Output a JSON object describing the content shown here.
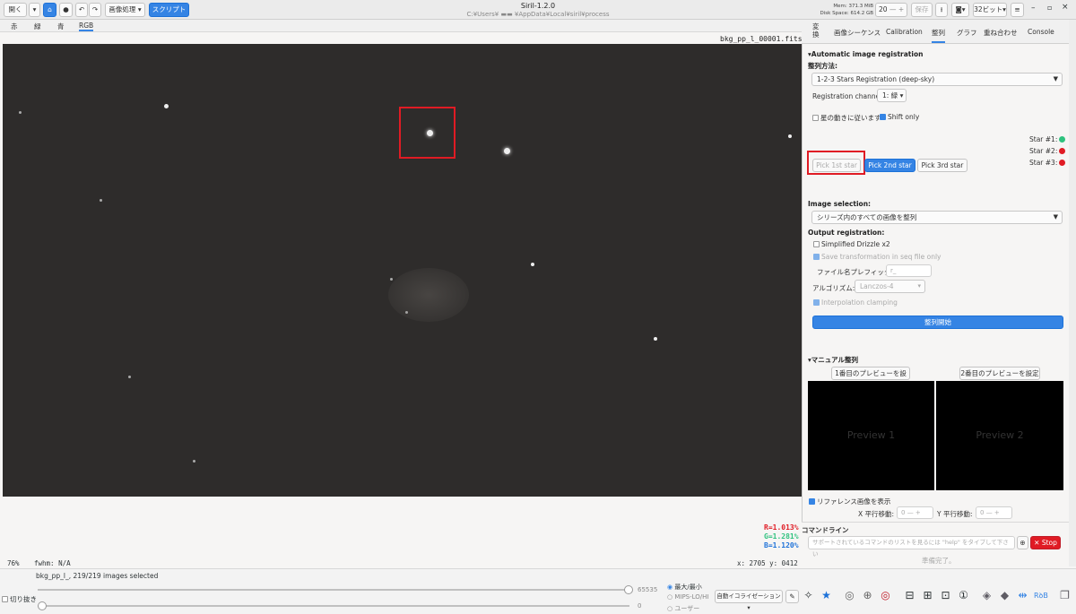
{
  "titlebar": {
    "open_label": "開く",
    "image_processing_label": "画像処理",
    "scripts_label": "スクリプト",
    "app_title": "Siril-1.2.0",
    "path": "C:¥Users¥ ▬▬ ¥AppData¥Local¥siril¥process",
    "mem": "Mem: 371.3 MiB",
    "disk": "Disk Space: 614.2 GB",
    "threads": "20",
    "save_label": "保存",
    "bit_depth": "32ビット"
  },
  "channels": [
    "赤",
    "緑",
    "青",
    "RGB"
  ],
  "viewer": {
    "filename": "bkg_pp_l_00001.fits",
    "zoom": "76%",
    "fwhm": "fwhm: N/A",
    "coords": "x: 2705 y: 0412",
    "r": "R=1.013%",
    "g": "G=1.281%",
    "b": "B=1.120%",
    "colors": {
      "r": "#e01b24",
      "g": "#2ec27e",
      "b": "#1c71d8"
    }
  },
  "sequence": {
    "info": "bkg_pp_l_, 219/219 images selected",
    "crop_label": "切り抜き",
    "max_value": "65535",
    "min_value": "0",
    "mode_max_min": "最大/最小",
    "mode_mips": "MIPS-LO/HI",
    "mode_user": "ユーザー",
    "auto_label": "自動イコライゼーション"
  },
  "tabs": [
    "変換",
    "画像シーケンス",
    "Calibration",
    "整列",
    "グラフ",
    "重ね合わせ",
    "Console"
  ],
  "registration": {
    "section": "Automatic image registration",
    "method_label": "整列方法:",
    "method_value": "1-2-3 Stars Registration (deep-sky)",
    "channel_label": "Registration channel:",
    "channel_value": "1: 緑",
    "follow_label": "星の動きに従います",
    "shift_label": "Shift only",
    "star1": "Star #1:",
    "star2": "Star #2:",
    "star3": "Star #3:",
    "pick1": "Pick 1st star",
    "pick2": "Pick 2nd star",
    "pick3": "Pick 3rd star",
    "image_selection_label": "Image selection:",
    "image_selection_value": "シリーズ内のすべての画像を整列",
    "output_label": "Output registration:",
    "drizzle_label": "Simplified Drizzle x2",
    "save_transform_label": "Save transformation in seq file only",
    "prefix_label": "ファイル名プレフィックス:",
    "prefix_value": "r_",
    "algo_label": "アルゴリズム:",
    "algo_value": "Lanczos-4",
    "clamp_label": "Interpolation clamping",
    "start_label": "整列開始"
  },
  "manual": {
    "section": "マニュアル整列",
    "set_preview1": "1番目のプレビューを設定",
    "set_preview2": "2番目のプレビューを設定",
    "preview1": "Preview 1",
    "preview2": "Preview 2",
    "show_ref_label": "リファレンス画像を表示",
    "x_shift_label": "X 平行移動:",
    "y_shift_label": "Y 平行移動:",
    "x_value": "0",
    "y_value": "0"
  },
  "console": {
    "label": "コマンドライン",
    "placeholder": "サポートされているコマンドのリストを見るには \"help\" をタイプして下さい",
    "stop_label": "Stop",
    "status": "準備完了。"
  }
}
